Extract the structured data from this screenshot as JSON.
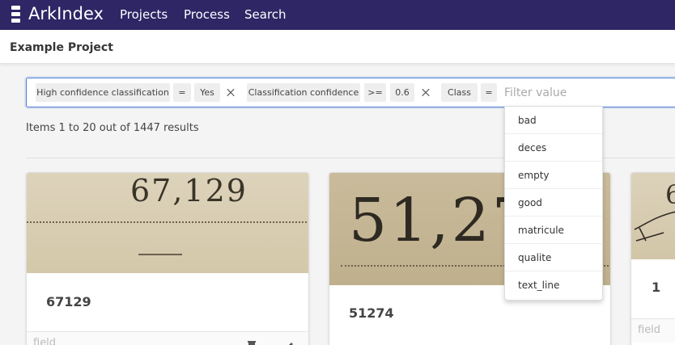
{
  "navbar": {
    "brand": "ArkIndex",
    "links": [
      "Projects",
      "Process",
      "Search"
    ]
  },
  "project": {
    "title": "Example Project"
  },
  "filters": {
    "chips": [
      {
        "field": "High confidence classification",
        "operator": "=",
        "value": "Yes"
      },
      {
        "field": "Classification confidence",
        "operator": ">=",
        "value": "0.6"
      },
      {
        "field": "Class",
        "operator": "="
      }
    ],
    "input_placeholder": "Filter value"
  },
  "dropdown": {
    "options": [
      "bad",
      "deces",
      "empty",
      "good",
      "matricule",
      "qualite",
      "text_line"
    ]
  },
  "results": {
    "summary": "Items 1 to 20 out of 1447 results"
  },
  "cards": [
    {
      "thumb_text": "67,129",
      "title": "67129",
      "field_label": "field"
    },
    {
      "thumb_text": "51,27",
      "title": "51274"
    },
    {
      "thumb_text": "6",
      "title": "1",
      "field_label": "field"
    }
  ],
  "colors": {
    "navbar": "#2f2666",
    "focus_border": "#4a7bd8",
    "thumb_background": "#d9cdb0"
  },
  "icons": [
    "arkindex-logo-icon",
    "close-icon",
    "trash-icon",
    "edit-icon"
  ]
}
